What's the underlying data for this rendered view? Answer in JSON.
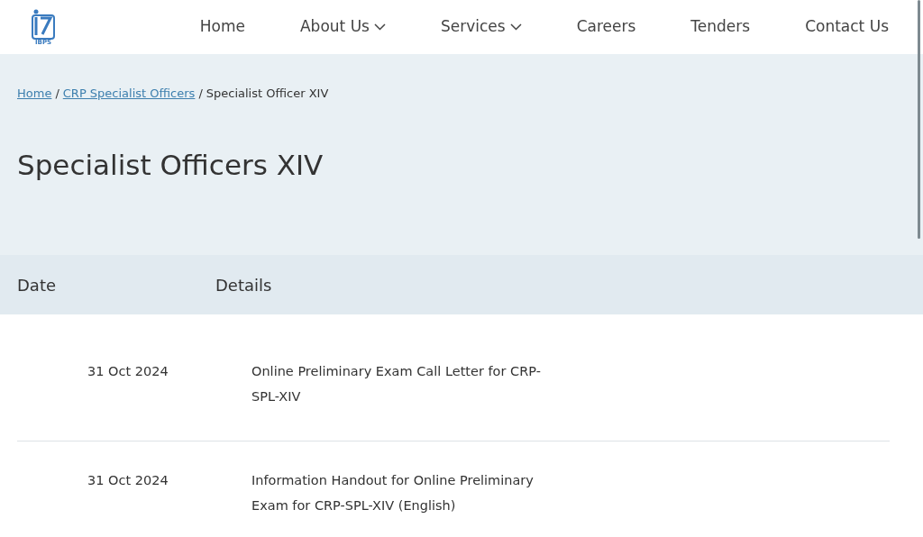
{
  "logo": {
    "text": "IBPS"
  },
  "nav": [
    {
      "label": "Home",
      "dropdown": false
    },
    {
      "label": "About Us",
      "dropdown": true
    },
    {
      "label": "Services",
      "dropdown": true
    },
    {
      "label": "Careers",
      "dropdown": false
    },
    {
      "label": "Tenders",
      "dropdown": false
    },
    {
      "label": "Contact Us",
      "dropdown": false
    }
  ],
  "breadcrumb": [
    {
      "kind": "link",
      "label": "Home"
    },
    {
      "kind": "separator",
      "label": "/"
    },
    {
      "kind": "link",
      "label": "CRP Specialist Officers"
    },
    {
      "kind": "separator",
      "label": "/"
    },
    {
      "kind": "current",
      "label": "Specialist Officer XIV"
    }
  ],
  "page_title": "Specialist Officers XIV",
  "table": {
    "columns": [
      "Date",
      "Details"
    ],
    "rows": [
      {
        "date": "31 Oct 2024",
        "details": "Online Preliminary Exam Call Letter for CRP-SPL-XIV"
      },
      {
        "date": "31 Oct 2024",
        "details": "Information Handout for Online Preliminary Exam for CRP-SPL-XIV (English)"
      }
    ]
  }
}
